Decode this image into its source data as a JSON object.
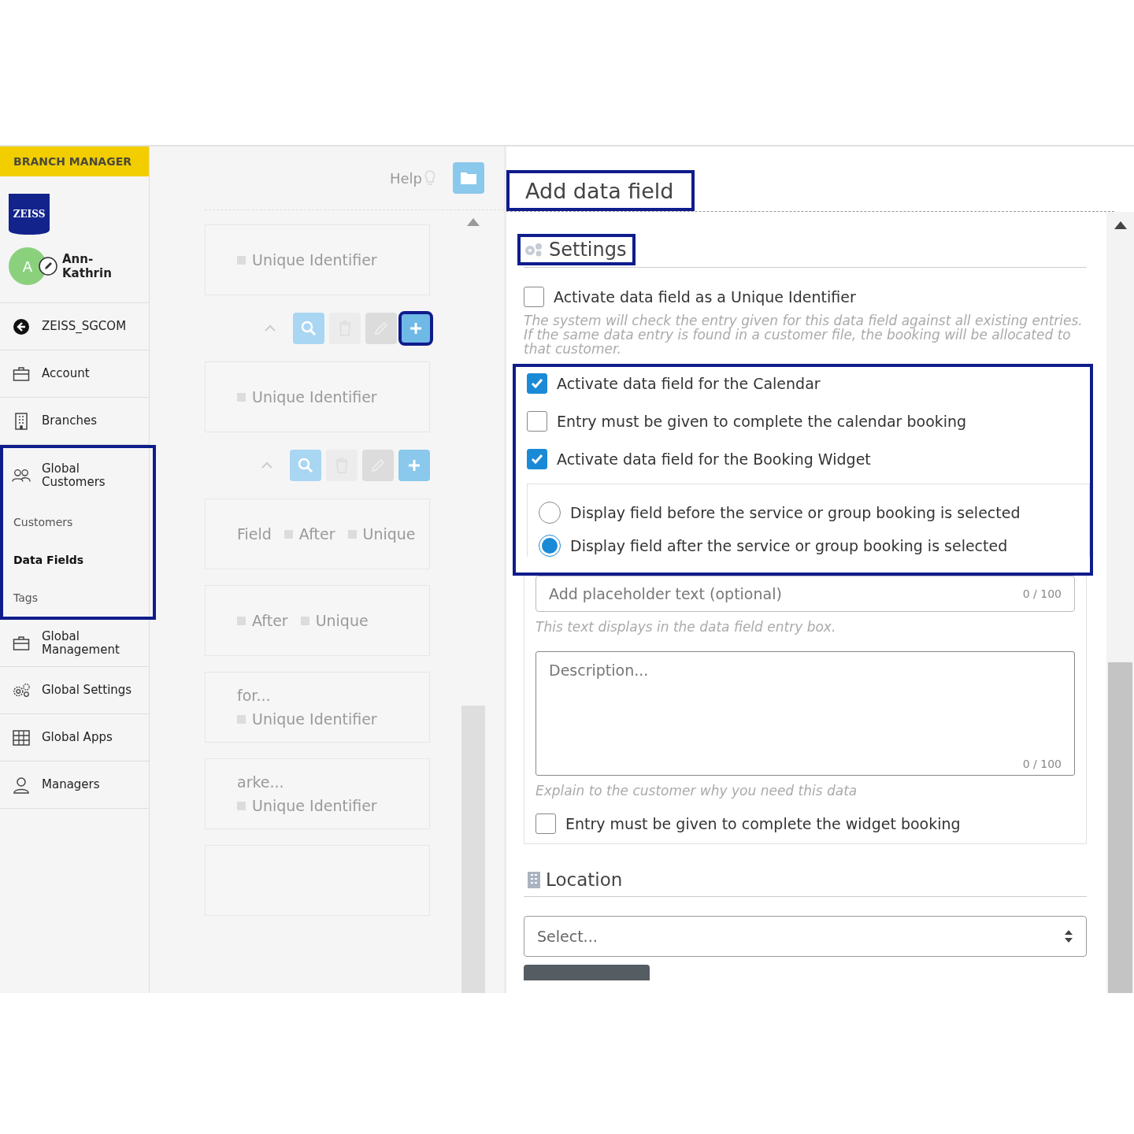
{
  "sidebar": {
    "role_badge": "BRANCH MANAGER",
    "logo_text": "ZEISS",
    "user": {
      "initial": "A",
      "name": "Ann-Kathrin"
    },
    "nav": [
      {
        "label": "ZEISS_SGCOM",
        "kind": "back"
      },
      {
        "label": "Account",
        "kind": "briefcase"
      },
      {
        "label": "Branches",
        "kind": "building"
      },
      {
        "label": "Global Customers",
        "kind": "people",
        "highlighted": true,
        "children": [
          {
            "label": "Customers",
            "selected": false
          },
          {
            "label": "Data Fields",
            "selected": true
          },
          {
            "label": "Tags",
            "selected": false
          }
        ]
      },
      {
        "label": "Global Management",
        "kind": "briefcase"
      },
      {
        "label": "Global Settings",
        "kind": "gears"
      },
      {
        "label": "Global Apps",
        "kind": "grid"
      },
      {
        "label": "Managers",
        "kind": "person"
      }
    ]
  },
  "list_panel": {
    "help_label": "Help",
    "items": [
      {
        "kind": "card",
        "tags": [
          "Unique Identifier"
        ]
      },
      {
        "kind": "toolbar",
        "highlighted": true
      },
      {
        "kind": "card",
        "tags": [
          "Unique Identifier"
        ]
      },
      {
        "kind": "toolbar",
        "highlighted": false
      },
      {
        "kind": "card",
        "label": "Field",
        "tags": [
          "After",
          "Unique"
        ]
      },
      {
        "kind": "card",
        "tags": [
          "After",
          "Unique"
        ]
      },
      {
        "kind": "card",
        "title": "for...",
        "tags": [
          "Unique Identifier"
        ]
      },
      {
        "kind": "card",
        "title": "arke...",
        "tags": [
          "Unique Identifier"
        ]
      },
      {
        "kind": "card"
      }
    ]
  },
  "editor": {
    "title": "Add data field",
    "title_highlighted": true,
    "settings": {
      "heading": "Settings",
      "heading_highlighted": true,
      "unique": {
        "label": "Activate data field as a Unique Identifier",
        "checked": false,
        "hint": "The system will check the entry given for this data field against all existing entries. If the same data entry is found in a customer file, the booking will be allocated to that customer."
      },
      "group_highlighted": true,
      "options": [
        {
          "label": "Activate data field for the Calendar",
          "checked": true
        },
        {
          "label": "Entry must be given to complete the calendar booking",
          "checked": false
        },
        {
          "label": "Activate data field for the Booking Widget",
          "checked": true
        }
      ],
      "radios": [
        {
          "label": "Display field before the service or group booking is selected",
          "selected": false
        },
        {
          "label": "Display field after the service or group booking is selected",
          "selected": true
        }
      ],
      "placeholder_field": {
        "placeholder": "Add placeholder text (optional)",
        "counter": "0 / 100",
        "hint": "This text displays in the data field entry box."
      },
      "description_field": {
        "placeholder": "Description...",
        "counter": "0 / 100",
        "hint": "Explain to the customer why you need this data"
      },
      "widget_required": {
        "label": "Entry must be given to complete the widget booking",
        "checked": false
      }
    },
    "location": {
      "heading": "Location",
      "select_placeholder": "Select..."
    }
  }
}
